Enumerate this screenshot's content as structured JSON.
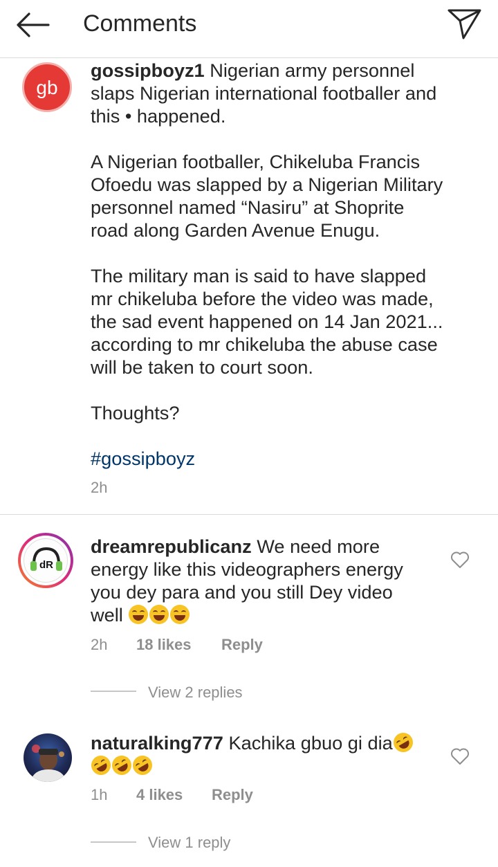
{
  "header": {
    "title": "Comments"
  },
  "post": {
    "username": "gossipboyz1",
    "avatar_text": "gb",
    "avatar_color": "#e53935",
    "caption": " Nigerian army personnel\nslaps Nigerian international footballer and\nthis • happened.\n\nA Nigerian footballer, Chikeluba Francis\nOfoedu was slapped by a Nigerian Military\npersonnel named “Nasiru” at Shoprite\nroad along Garden Avenue Enugu.\n\nThe military man is said to have slapped\nmr chikeluba before the video was made,\nthe sad event happened on 14 Jan 2021...\naccording to mr chikeluba the abuse case\nwill be taken to court soon.\n\nThoughts?\n\n",
    "hashtag": "#gossipboyz",
    "time": "2h"
  },
  "comments": [
    {
      "username": "dreamrepublicanz",
      "text": " We need more\nenergy like this videographers energy\nyou dey para and you still Dey video\nwell ",
      "emoji_name": "face-with-tears-of-joy",
      "time": "2h",
      "likes": "18 likes",
      "reply": "Reply",
      "view_replies": "View 2 replies",
      "avatar_text": "dR"
    },
    {
      "username": "naturalking777",
      "text": " Kachika gbuo gi dia",
      "emoji_name": "rolling-on-the-floor-laughing",
      "time": "1h",
      "likes": "4 likes",
      "reply": "Reply",
      "view_replies": "View 1 reply"
    }
  ],
  "colors": {
    "hashtag": "#003569",
    "secondary_text": "#8e8e8e",
    "ring_gradient": [
      "#f58529",
      "#dd2a7b",
      "#8134af"
    ]
  }
}
